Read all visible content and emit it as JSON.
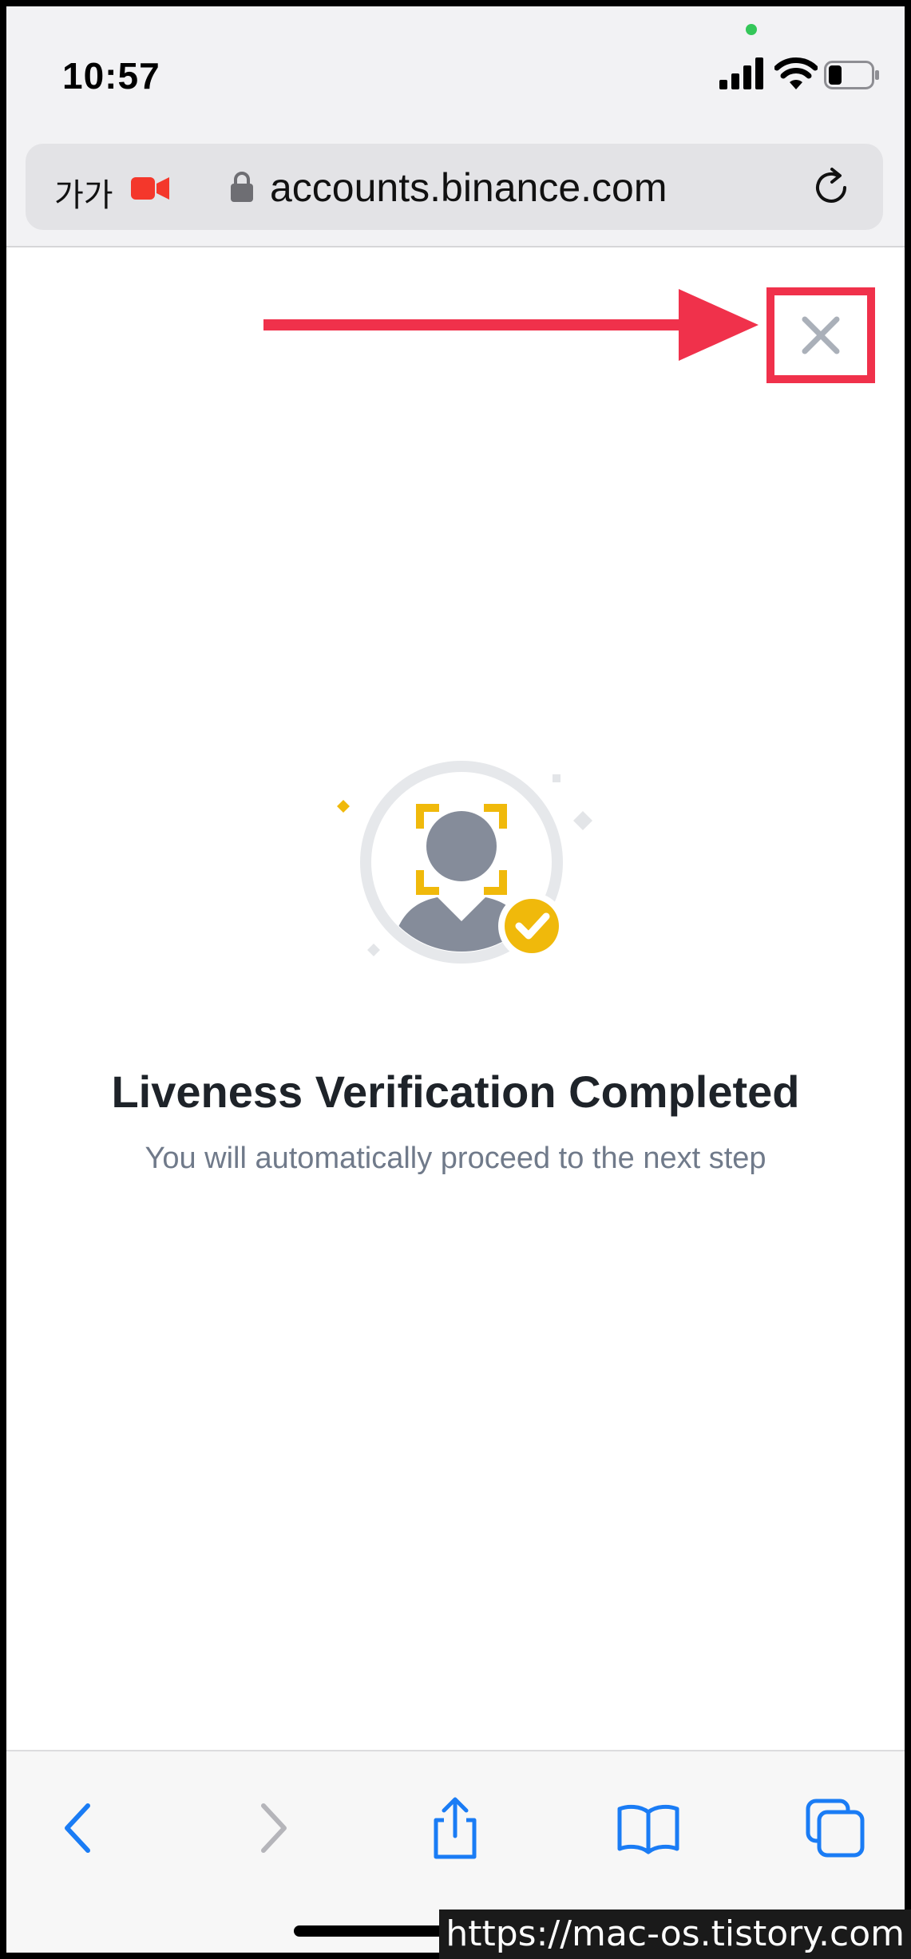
{
  "status_bar": {
    "time": "10:57"
  },
  "address_bar": {
    "reader_label": "가가",
    "url": "accounts.binance.com"
  },
  "annotation": {
    "highlight_color": "#f0314b"
  },
  "verification": {
    "title": "Liveness Verification Completed",
    "subtitle": "You will automatically proceed to the next step",
    "accent_color": "#f0b90b"
  },
  "toolbar": {
    "buttons": [
      "back-icon",
      "forward-icon",
      "share-icon",
      "bookmarks-icon",
      "tabs-icon"
    ]
  },
  "watermark": "https://mac-os.tistory.com"
}
